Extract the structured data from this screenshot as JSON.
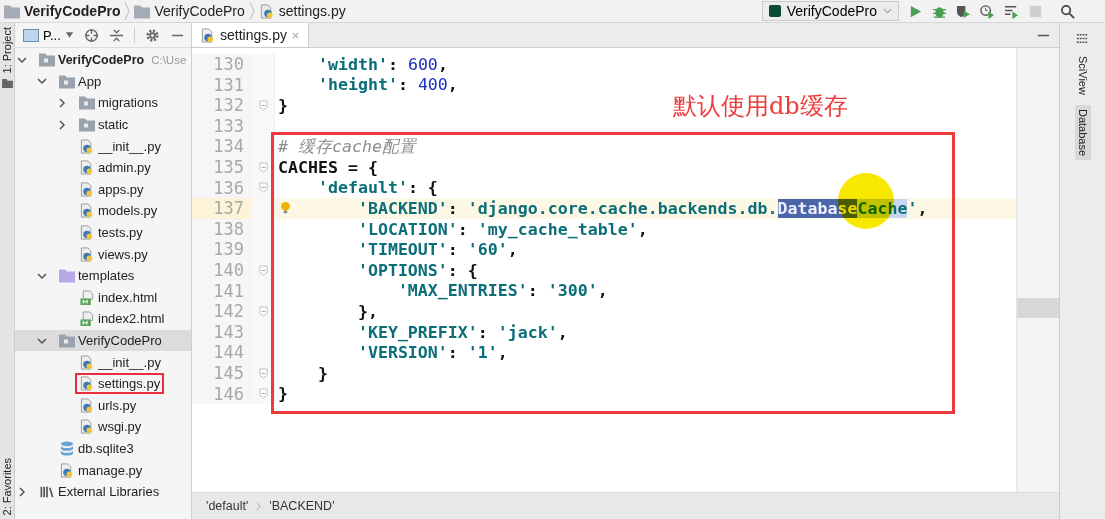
{
  "nav_bar": {
    "crumbs": [
      {
        "label": "VerifyCodePro",
        "kind": "root"
      },
      {
        "label": "VerifyCodePro",
        "kind": "folder"
      },
      {
        "label": "settings.py",
        "kind": "python"
      }
    ]
  },
  "run_config": {
    "label": "VerifyCodePro"
  },
  "left_tool_strip": [
    "1: Project",
    "2: Favorites"
  ],
  "project_panel": {
    "view": "P...",
    "tree": [
      {
        "name": "VerifyCodePro",
        "hint": "C:\\Use",
        "kind": "root",
        "expanded": true,
        "selected": false,
        "marked": false,
        "children": [
          {
            "name": "App",
            "kind": "folder",
            "expanded": true,
            "selected": false,
            "marked": false,
            "children": [
              {
                "name": "migrations",
                "kind": "folder",
                "expanded": false,
                "selected": false,
                "marked": false
              },
              {
                "name": "static",
                "kind": "folder",
                "expanded": false,
                "selected": false,
                "marked": false
              },
              {
                "name": "__init__.py",
                "kind": "python",
                "selected": false,
                "marked": false
              },
              {
                "name": "admin.py",
                "kind": "python",
                "selected": false,
                "marked": false
              },
              {
                "name": "apps.py",
                "kind": "python",
                "selected": false,
                "marked": false
              },
              {
                "name": "models.py",
                "kind": "python",
                "selected": false,
                "marked": false
              },
              {
                "name": "tests.py",
                "kind": "python",
                "selected": false,
                "marked": false
              },
              {
                "name": "views.py",
                "kind": "python",
                "selected": false,
                "marked": false
              }
            ]
          },
          {
            "name": "templates",
            "kind": "templates",
            "expanded": true,
            "selected": false,
            "marked": false,
            "children": [
              {
                "name": "index.html",
                "kind": "html",
                "selected": false,
                "marked": false
              },
              {
                "name": "index2.html",
                "kind": "html",
                "selected": false,
                "marked": false
              }
            ]
          },
          {
            "name": "VerifyCodePro",
            "kind": "folder",
            "expanded": true,
            "selected": true,
            "marked": false,
            "children": [
              {
                "name": "__init__.py",
                "kind": "python",
                "selected": false,
                "marked": false
              },
              {
                "name": "settings.py",
                "kind": "python",
                "selected": false,
                "marked": true
              },
              {
                "name": "urls.py",
                "kind": "python",
                "selected": false,
                "marked": false
              },
              {
                "name": "wsgi.py",
                "kind": "python",
                "selected": false,
                "marked": false
              }
            ]
          },
          {
            "name": "db.sqlite3",
            "kind": "db",
            "selected": false,
            "marked": false
          },
          {
            "name": "manage.py",
            "kind": "python",
            "selected": false,
            "marked": false
          }
        ]
      },
      {
        "name": "External Libraries",
        "kind": "library",
        "expanded": false,
        "selected": false,
        "marked": false
      }
    ]
  },
  "editor": {
    "tab": {
      "label": "settings.py",
      "selected": true
    },
    "annotation": "默认使用db缓存",
    "lines": [
      {
        "number": "130",
        "current": false,
        "fold": false,
        "intention": false,
        "tokens": [
          {
            "kind": "str",
            "text": "    'width'"
          },
          {
            "kind": "punct",
            "text": ": "
          },
          {
            "kind": "num",
            "text": "600"
          },
          {
            "kind": "punct",
            "text": ","
          }
        ]
      },
      {
        "number": "131",
        "current": false,
        "fold": false,
        "intention": false,
        "tokens": [
          {
            "kind": "str",
            "text": "    'height'"
          },
          {
            "kind": "punct",
            "text": ": "
          },
          {
            "kind": "num",
            "text": "400"
          },
          {
            "kind": "punct",
            "text": ","
          }
        ]
      },
      {
        "number": "132",
        "current": false,
        "fold": true,
        "intention": false,
        "tokens": [
          {
            "kind": "punct",
            "text": "}"
          }
        ]
      },
      {
        "number": "133",
        "current": false,
        "fold": false,
        "intention": false
      },
      {
        "number": "134",
        "current": false,
        "fold": false,
        "intention": false,
        "tokens": [
          {
            "kind": "comment",
            "text": "# 缓存cache配置"
          }
        ]
      },
      {
        "number": "135",
        "current": false,
        "fold": true,
        "intention": false,
        "tokens": [
          {
            "kind": "punct",
            "text": "CACHES = {"
          }
        ]
      },
      {
        "number": "136",
        "current": false,
        "fold": true,
        "intention": false,
        "tokens": [
          {
            "kind": "str",
            "text": "    'default'"
          },
          {
            "kind": "punct",
            "text": ": {"
          }
        ]
      },
      {
        "number": "137",
        "current": true,
        "fold": false,
        "intention": true,
        "tokens": [
          {
            "kind": "str",
            "text": "        'BACKEND'"
          },
          {
            "kind": "punct",
            "text": ": "
          },
          {
            "kind": "str",
            "text": "'django.core.cache.backends.db."
          },
          {
            "kind": "sel",
            "text": "Database"
          },
          {
            "kind": "sel-light",
            "text": "Cache"
          },
          {
            "kind": "str",
            "text": "'"
          },
          {
            "kind": "punct",
            "text": ","
          }
        ]
      },
      {
        "number": "138",
        "current": false,
        "fold": false,
        "intention": false,
        "tokens": [
          {
            "kind": "str",
            "text": "        'LOCATION'"
          },
          {
            "kind": "punct",
            "text": ": "
          },
          {
            "kind": "str",
            "text": "'my_cache_table'"
          },
          {
            "kind": "punct",
            "text": ","
          }
        ]
      },
      {
        "number": "139",
        "current": false,
        "fold": false,
        "intention": false,
        "tokens": [
          {
            "kind": "str",
            "text": "        'TIMEOUT'"
          },
          {
            "kind": "punct",
            "text": ": "
          },
          {
            "kind": "str",
            "text": "'60'"
          },
          {
            "kind": "punct",
            "text": ","
          }
        ]
      },
      {
        "number": "140",
        "current": false,
        "fold": true,
        "intention": false,
        "tokens": [
          {
            "kind": "str",
            "text": "        'OPTIONS'"
          },
          {
            "kind": "punct",
            "text": ": {"
          }
        ]
      },
      {
        "number": "141",
        "current": false,
        "fold": false,
        "intention": false,
        "tokens": [
          {
            "kind": "str",
            "text": "            'MAX_ENTRIES'"
          },
          {
            "kind": "punct",
            "text": ": "
          },
          {
            "kind": "str",
            "text": "'300'"
          },
          {
            "kind": "punct",
            "text": ","
          }
        ]
      },
      {
        "number": "142",
        "current": false,
        "fold": true,
        "intention": false,
        "tokens": [
          {
            "kind": "punct",
            "text": "        },"
          }
        ]
      },
      {
        "number": "143",
        "current": false,
        "fold": false,
        "intention": false,
        "tokens": [
          {
            "kind": "str",
            "text": "        'KEY_PREFIX'"
          },
          {
            "kind": "punct",
            "text": ": "
          },
          {
            "kind": "str",
            "text": "'jack'"
          },
          {
            "kind": "punct",
            "text": ","
          }
        ]
      },
      {
        "number": "144",
        "current": false,
        "fold": false,
        "intention": false,
        "tokens": [
          {
            "kind": "str",
            "text": "        'VERSION'"
          },
          {
            "kind": "punct",
            "text": ": "
          },
          {
            "kind": "str",
            "text": "'1'"
          },
          {
            "kind": "punct",
            "text": ","
          }
        ]
      },
      {
        "number": "145",
        "current": false,
        "fold": true,
        "intention": false,
        "tokens": [
          {
            "kind": "punct",
            "text": "    }"
          }
        ]
      },
      {
        "number": "146",
        "current": false,
        "fold": true,
        "intention": false,
        "tokens": [
          {
            "kind": "punct",
            "text": "}"
          }
        ]
      }
    ],
    "breadcrumbs": [
      "'default'",
      "'BACKEND'"
    ]
  },
  "right_tool_strip": [
    "SciView",
    "Database"
  ]
}
